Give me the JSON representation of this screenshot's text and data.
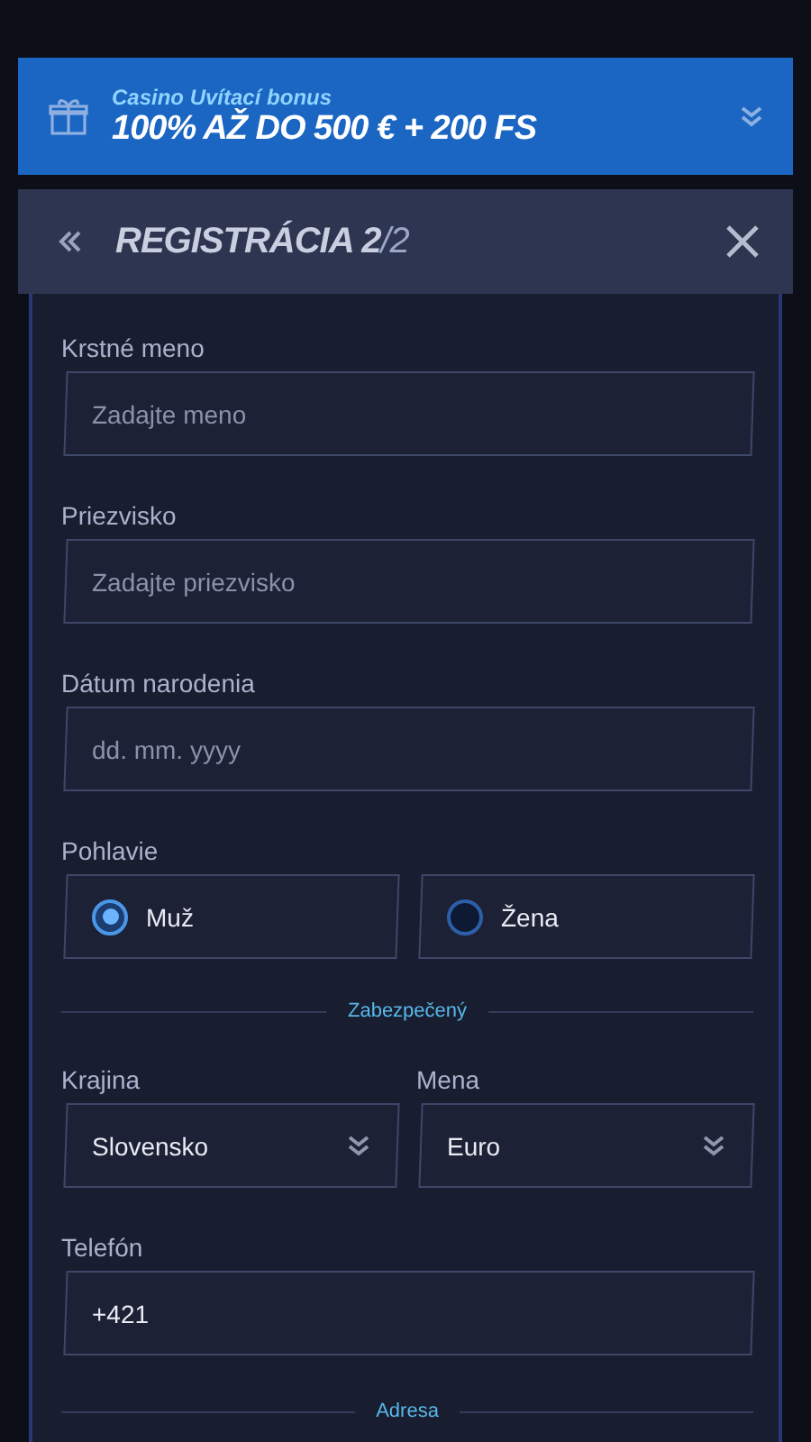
{
  "banner": {
    "subtitle": "Casino Uvítací bonus",
    "title": "100% AŽ DO 500 € + 200 FS",
    "expanded": false
  },
  "header": {
    "title": "REGISTRÁCIA 2",
    "step": "/2"
  },
  "form": [
    {
      "kind": "text",
      "label": "Krstné meno",
      "placeholder": "Zadajte meno"
    },
    {
      "kind": "text",
      "label": "Priezvisko",
      "placeholder": "Zadajte priezvisko"
    },
    {
      "kind": "text",
      "label": "Dátum narodenia",
      "placeholder": "dd. mm. yyyy"
    },
    {
      "kind": "radio",
      "label": "Pohlavie",
      "options": [
        {
          "label": "Muž",
          "selected": true
        },
        {
          "label": "Žena",
          "selected": false
        }
      ]
    },
    {
      "kind": "divider",
      "label": "Zabezpečený"
    },
    {
      "kind": "selects",
      "fields": [
        {
          "label": "Krajina",
          "value": "Slovensko"
        },
        {
          "label": "Mena",
          "value": "Euro"
        }
      ]
    },
    {
      "kind": "text",
      "label": "Telefón",
      "value": "+421"
    },
    {
      "kind": "divider",
      "label": "Adresa"
    }
  ]
}
